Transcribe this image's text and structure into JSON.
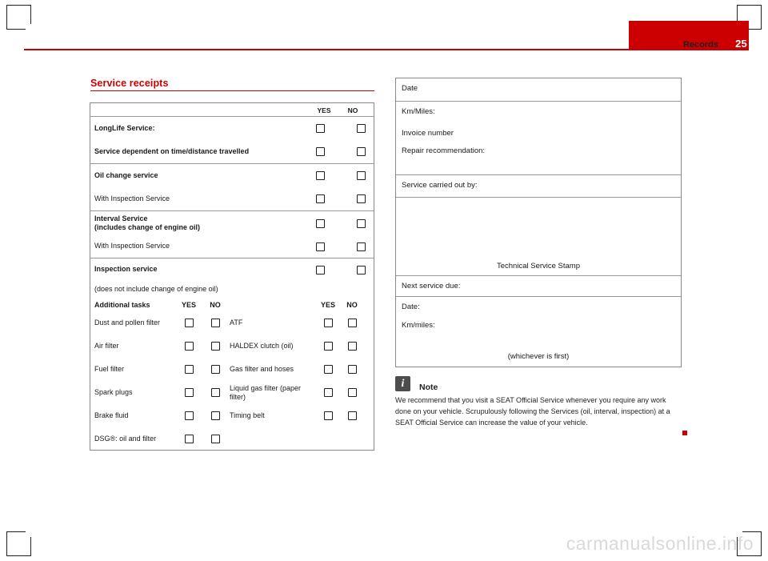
{
  "header": {
    "title": "Records",
    "page_number": "25",
    "accent_color": "#cc0000"
  },
  "section": {
    "title": "Service receipts"
  },
  "left_table": {
    "col_yes": "YES",
    "col_no": "NO",
    "rows": [
      {
        "label": "LongLife Service:",
        "bold": true,
        "boxes": 2
      },
      {
        "label": "Service dependent on time/distance travelled",
        "bold": true,
        "boxes": 2
      },
      {
        "label": "Oil change service",
        "bold": true,
        "boxes": 2
      },
      {
        "label": "With Inspection Service",
        "bold": false,
        "boxes": 2
      },
      {
        "label": "Interval Service\n(includes change of engine oil)",
        "bold": true,
        "boxes": 2
      },
      {
        "label": "With Inspection Service",
        "bold": false,
        "boxes": 2
      },
      {
        "label": "Inspection service",
        "bold": true,
        "boxes": 2
      },
      {
        "label": "(does not include change of engine oil)",
        "bold": false,
        "boxes": 0
      }
    ],
    "additional": {
      "heading": "Additional tasks",
      "col_yes_left": "YES",
      "col_no_left": "NO",
      "col_yes_right": "YES",
      "col_no_right": "NO",
      "rows": [
        {
          "left": "Dust and pollen filter",
          "right": "ATF"
        },
        {
          "left": "Air filter",
          "right": "HALDEX clutch (oil)"
        },
        {
          "left": "Fuel filter",
          "right": "Gas filter and hoses"
        },
        {
          "left": "Spark plugs",
          "right": "Liquid gas filter (paper filter)"
        },
        {
          "left": "Brake fluid",
          "right": "Timing belt"
        },
        {
          "left": "DSG®: oil and filter",
          "right": ""
        }
      ]
    }
  },
  "right_table": {
    "date_label": "Date",
    "km_miles_label": "Km/Miles:",
    "invoice_label": "Invoice number",
    "repair_label": "Repair recommendation:",
    "carried_out_label": "Service carried out by:",
    "stamp_label": "Technical Service Stamp",
    "next_service_label": "Next service due:",
    "next_date_label": "Date:",
    "next_km_label": "Km/miles:",
    "whichever_label": "(whichever is first)"
  },
  "note": {
    "icon": "information-icon",
    "title": "Note",
    "body": "We recommend that you visit a SEAT Official Service whenever you require any work done on your vehicle. Scrupulously following the Services (oil, interval, inspection) at a SEAT Official Service can increase the value of your vehicle."
  },
  "watermark": {
    "text": "carmanualsonline.info"
  }
}
